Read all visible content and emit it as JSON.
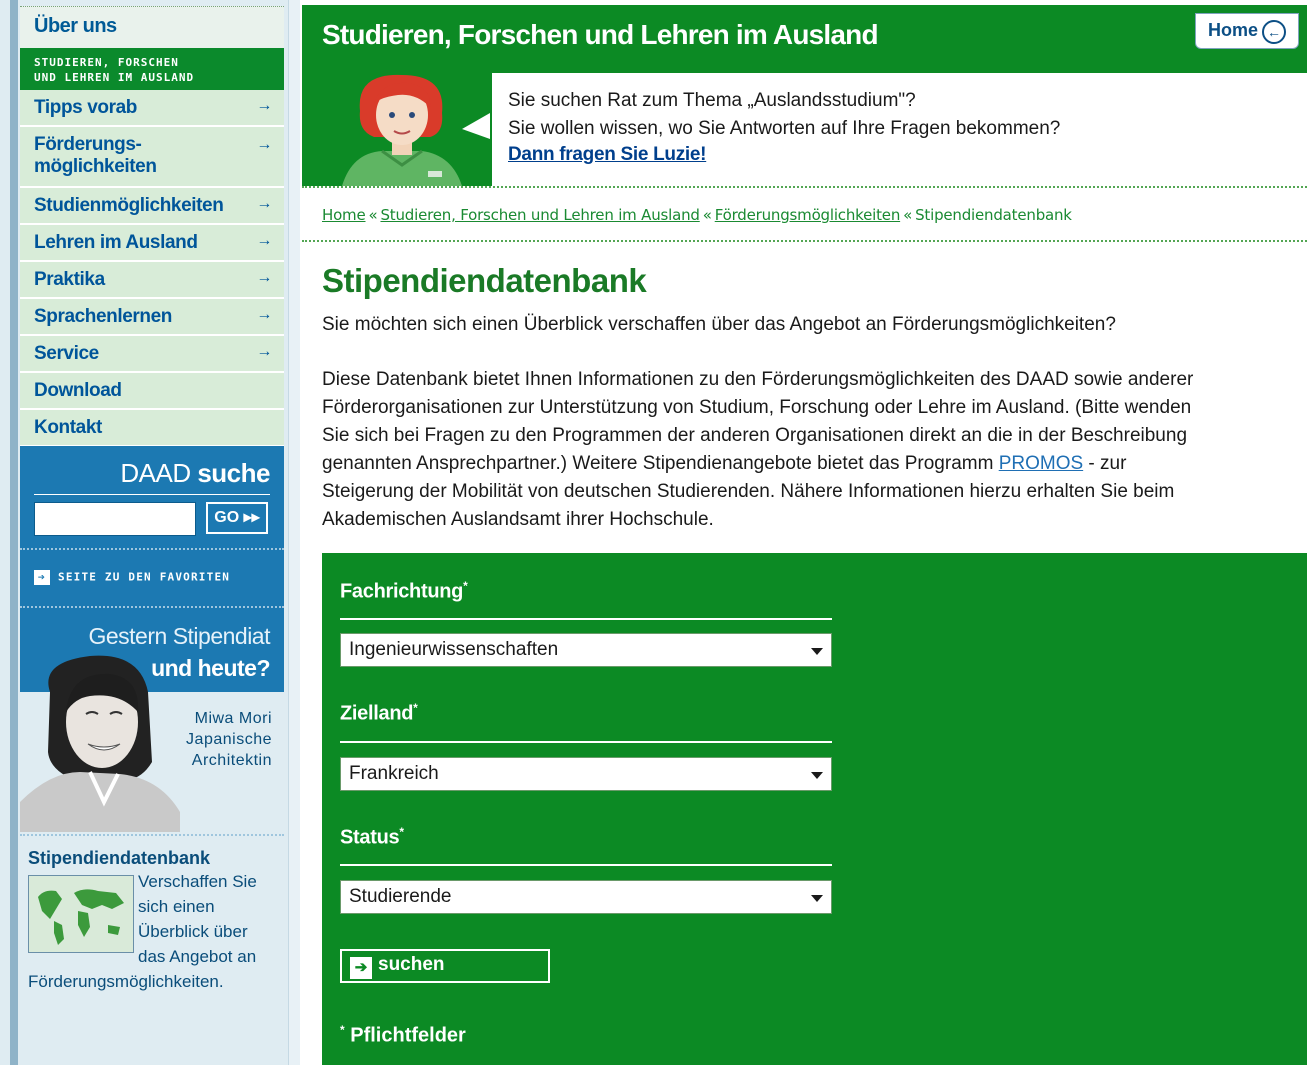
{
  "sidebar": {
    "top_link": "Über uns",
    "section_line1": "STUDIEREN, FORSCHEN",
    "section_line2": "UND LEHREN IM AUSLAND",
    "items": [
      {
        "label": "Tipps vorab",
        "arrow": "→"
      },
      {
        "label_line1": "Förderungs-",
        "label_line2": "möglichkeiten",
        "arrow": "→"
      },
      {
        "label": "Studienmöglichkeiten",
        "arrow": "→"
      },
      {
        "label": "Lehren im Ausland",
        "arrow": "→"
      },
      {
        "label": "Praktika",
        "arrow": "→"
      },
      {
        "label": "Sprachenlernen",
        "arrow": "→"
      },
      {
        "label": "Service",
        "arrow": "→"
      },
      {
        "label": "Download"
      },
      {
        "label": "Kontakt"
      }
    ],
    "search": {
      "title_regular": "DAAD",
      "title_bold": "suche",
      "input_value": "",
      "go_label": "GO ▸▸"
    },
    "favorites_label": "SEITE ZU DEN FAVORITEN",
    "feature": {
      "line1": "Gestern Stipendiat",
      "line2": "und heute?",
      "name": "Miwa Mori",
      "role_line1": "Japanische",
      "role_line2": "Architektin"
    },
    "stipendien": {
      "title": "Stipendiendatenbank",
      "text": "Verschaffen Sie sich einen Überblick über das Angebot an Förderungsmöglichkeiten."
    }
  },
  "header": {
    "title": "Studieren, Forschen und Lehren im Ausland",
    "home_label": "Home"
  },
  "luzie": {
    "line1": "Sie suchen Rat zum Thema „Auslandsstudium\"?",
    "line2": "Sie wollen wissen, wo Sie Antworten auf Ihre Fragen bekommen?",
    "link": "Dann fragen Sie Luzie!"
  },
  "breadcrumb": {
    "items": [
      "Home",
      "Studieren, Forschen und Lehren im Ausland",
      "Förderungsmöglichkeiten"
    ],
    "current": "Stipendiendatenbank",
    "separator": "«"
  },
  "content": {
    "title": "Stipendiendatenbank",
    "intro": "Sie möchten sich einen Überblick verschaffen über das Angebot an Förderungsmöglichkeiten?",
    "desc_lines": [
      "Diese Datenbank bietet Ihnen Informationen zu den Förderungsmöglichkeiten des DAAD sowie anderer",
      "Förderorganisationen zur Unterstützung von Studium, Forschung oder Lehre im Ausland. (Bitte wenden",
      "Sie sich bei Fragen zu den Programmen der anderen Organisationen direkt an die in der Beschreibung"
    ],
    "desc_line4_before": "genannten Ansprechpartner.) Weitere Stipendienangebote bietet das Programm ",
    "desc_link": "PROMOS",
    "desc_line4_after": " - zur",
    "desc_line5": "Steigerung der Mobilität von deutschen Studierenden. Nähere Informationen hierzu erhalten Sie beim",
    "desc_line6": "Akademischen Auslandsamt ihrer Hochschule."
  },
  "form": {
    "fachrichtung_label": "Fachrichtung",
    "fachrichtung_value": "Ingenieurwissenschaften",
    "zielland_label": "Zielland",
    "zielland_value": "Frankreich",
    "status_label": "Status",
    "status_value": "Studierende",
    "required_mark": "*",
    "submit_label": "suchen",
    "required_note": "Pflichtfelder"
  },
  "colors": {
    "brand_green": "#0c8a24",
    "nav_blue": "#1c79b2",
    "link_blue": "#00559a"
  }
}
